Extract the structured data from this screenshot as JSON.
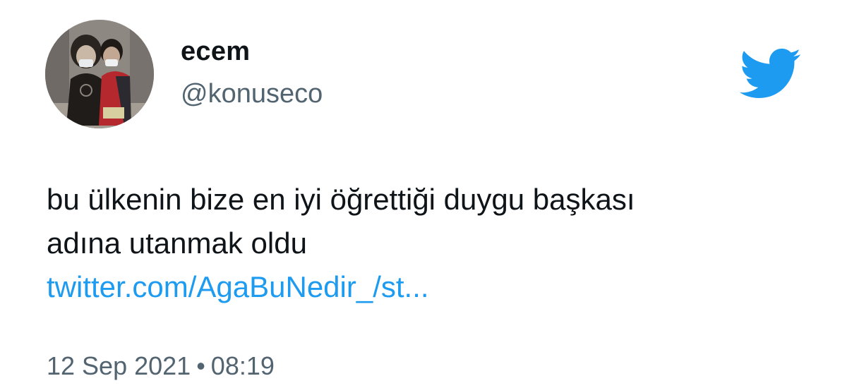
{
  "user": {
    "name": "ecem",
    "handle": "@konuseco",
    "avatar_icon": "profile-photo"
  },
  "tweet": {
    "text_line_1": "bu ülkenin bize en iyi öğrettiği duygu başkası",
    "text_line_2": "adına utanmak oldu",
    "link_text": "twitter.com/AgaBuNedir_/st...",
    "date": "12 Sep 2021",
    "separator": "•",
    "time": "08:19"
  },
  "brand": {
    "icon": "twitter-bird-icon",
    "accent_color": "#1d9bf0",
    "text_color": "#0f1419",
    "secondary_text_color": "#536471"
  }
}
